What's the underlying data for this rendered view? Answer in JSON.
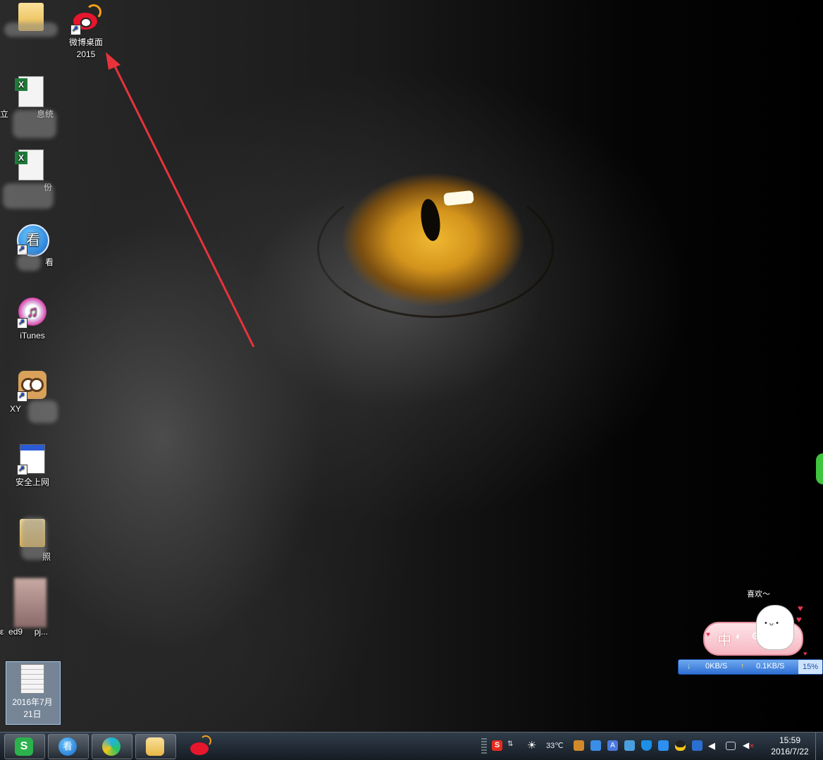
{
  "desktop": {
    "icons": [
      {
        "label": "",
        "visible_suffix": "",
        "type": "folder"
      },
      {
        "label": "微博桌面\n2015",
        "type": "weibo"
      },
      {
        "label": "",
        "visible_suffix": "立",
        "visible_suffix2": "息统",
        "type": "excel"
      },
      {
        "label": "",
        "visible_suffix": "份",
        "type": "excel"
      },
      {
        "label": "",
        "visible_suffix": "看",
        "type": "kankan"
      },
      {
        "label": "iTunes",
        "type": "itunes"
      },
      {
        "label": "",
        "visible_prefix": "XY",
        "type": "owl"
      },
      {
        "label": "安全上网",
        "type": "app"
      },
      {
        "label": "",
        "visible_suffix": "照",
        "type": "folder"
      },
      {
        "label": "",
        "visible_prefix": "ed9",
        "visible_suffix": "pj...",
        "visible_left": "ε",
        "type": "photo"
      },
      {
        "label": "2016年7月\n21日",
        "type": "doc",
        "selected": true
      }
    ]
  },
  "widgets": {
    "greeting": "喜欢～",
    "ime_char": "中",
    "net": {
      "down": "0KB/S",
      "up": "0.1KB/S",
      "percent": "15%"
    }
  },
  "taskbar": {
    "tray": {
      "temperature": "33℃"
    },
    "clock": {
      "time": "15:59",
      "date": "2016/7/22"
    }
  },
  "colors": {
    "taskbar": "#1e2731",
    "weibo_red": "#e6162d",
    "arrow_red": "#e8333b"
  }
}
